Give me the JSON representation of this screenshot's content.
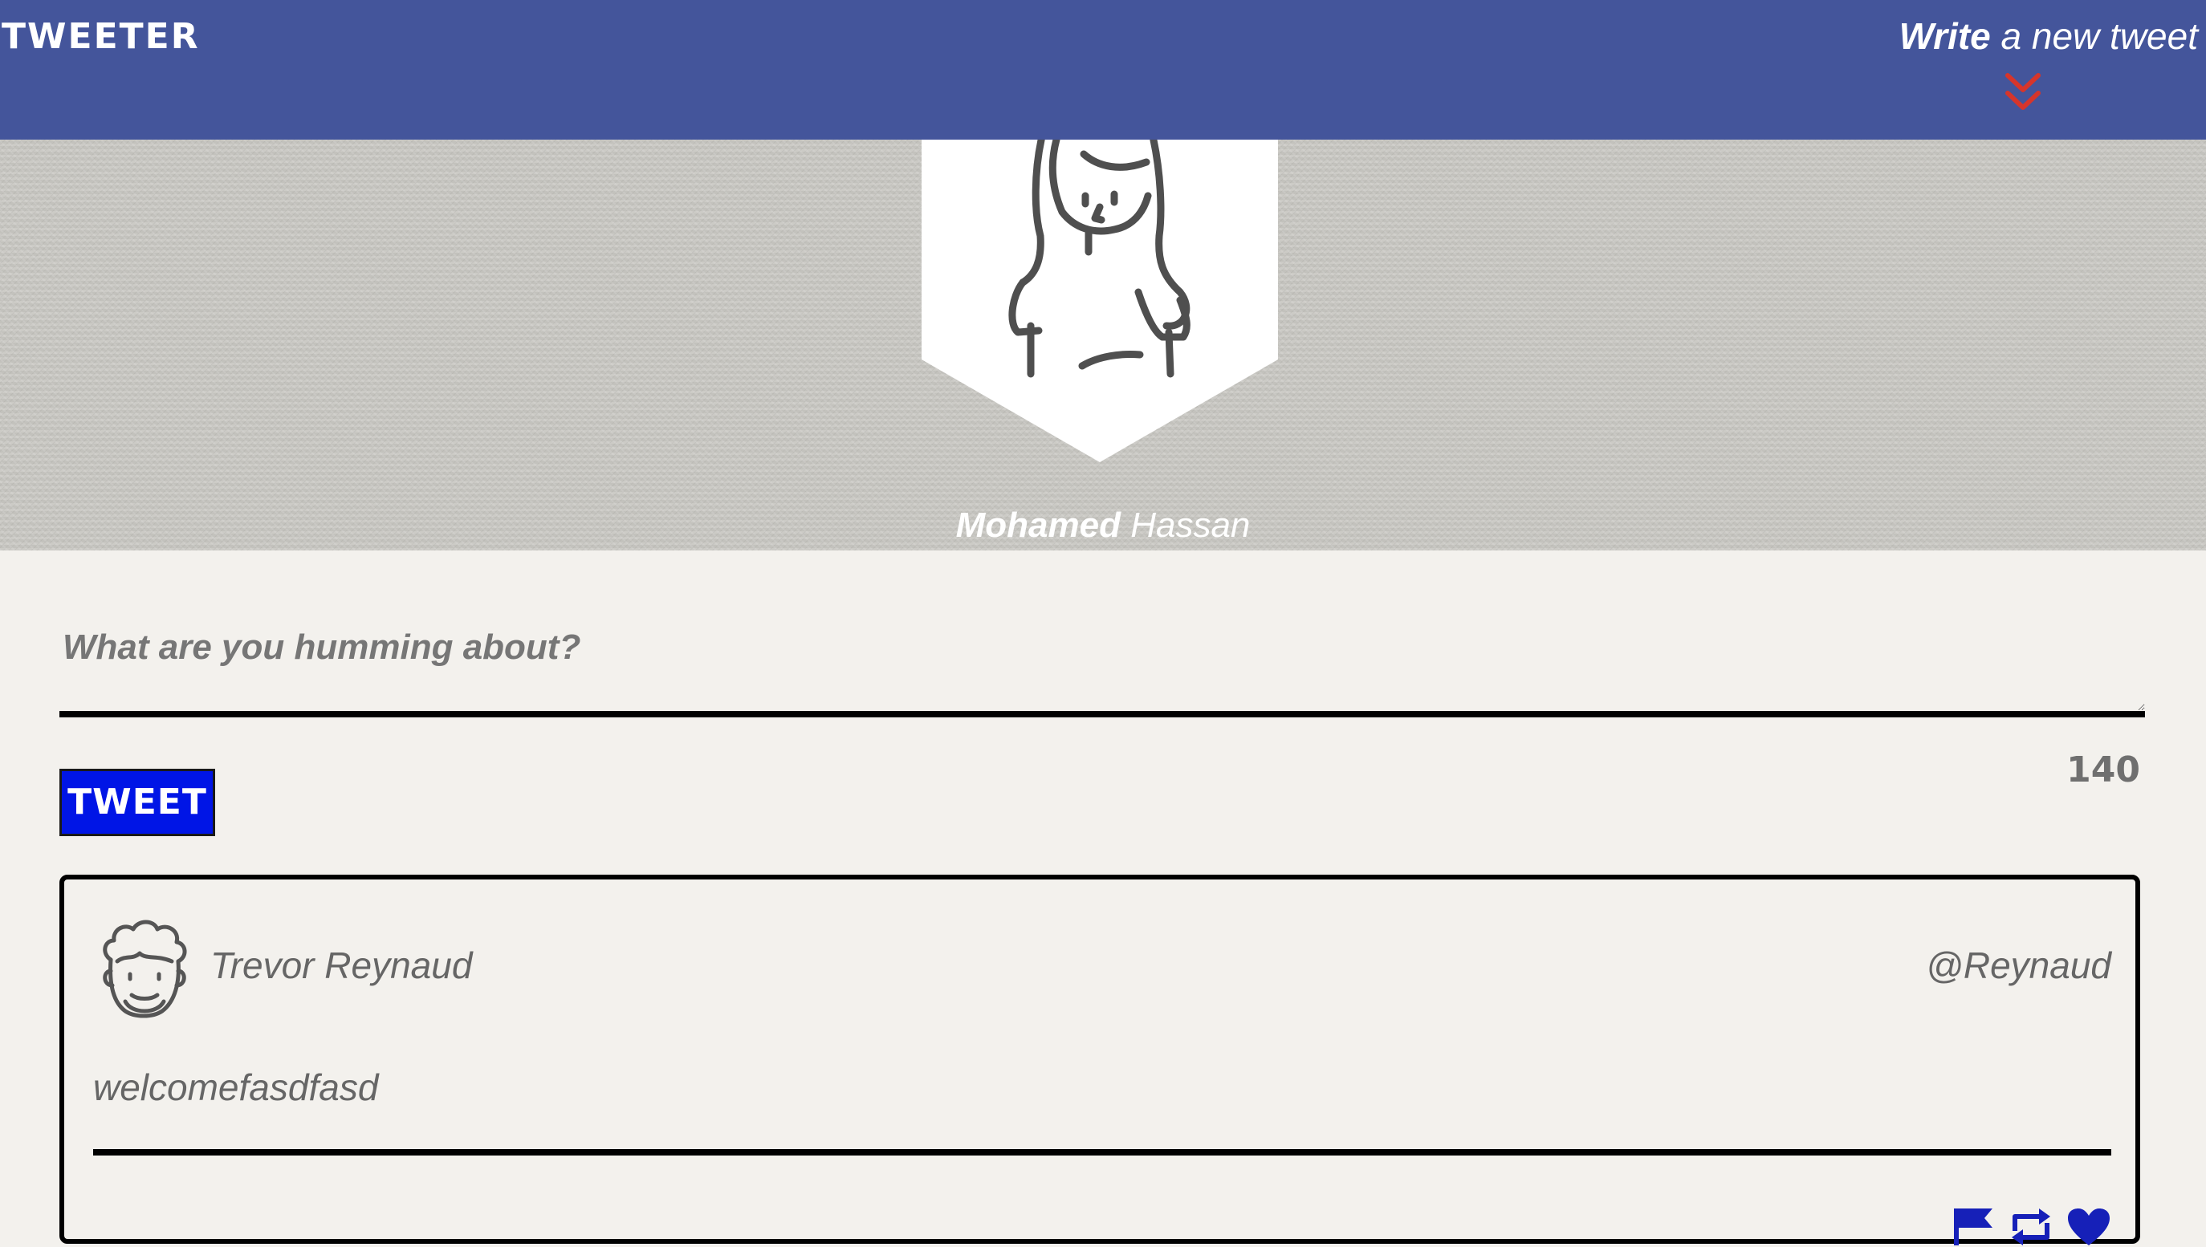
{
  "nav": {
    "brand": "TWEETER",
    "compose_toggle": {
      "label_bold": "Write",
      "label_rest": " a new tweet",
      "icon": "double-chevron-down-icon"
    }
  },
  "profile": {
    "first_name": "Mohamed",
    "last_name": " Hassan",
    "avatar_icon": "woman-avatar-icon"
  },
  "compose": {
    "placeholder": "What are you humming about?",
    "button_label": "TWEET",
    "char_counter": "140"
  },
  "tweets": [
    {
      "avatar_icon": "man-curly-hair-avatar-icon",
      "author": "Trevor Reynaud",
      "handle": "@Reynaud",
      "body": "welcomefasdfasd",
      "action_icons": [
        "flag-icon",
        "retweet-icon",
        "heart-icon"
      ]
    }
  ],
  "colors": {
    "nav_bg": "#44559b",
    "accent_red": "#d6352b",
    "button_blue": "#0015e6",
    "action_blue": "#1620b8",
    "page_bg": "#f3f1ed"
  }
}
